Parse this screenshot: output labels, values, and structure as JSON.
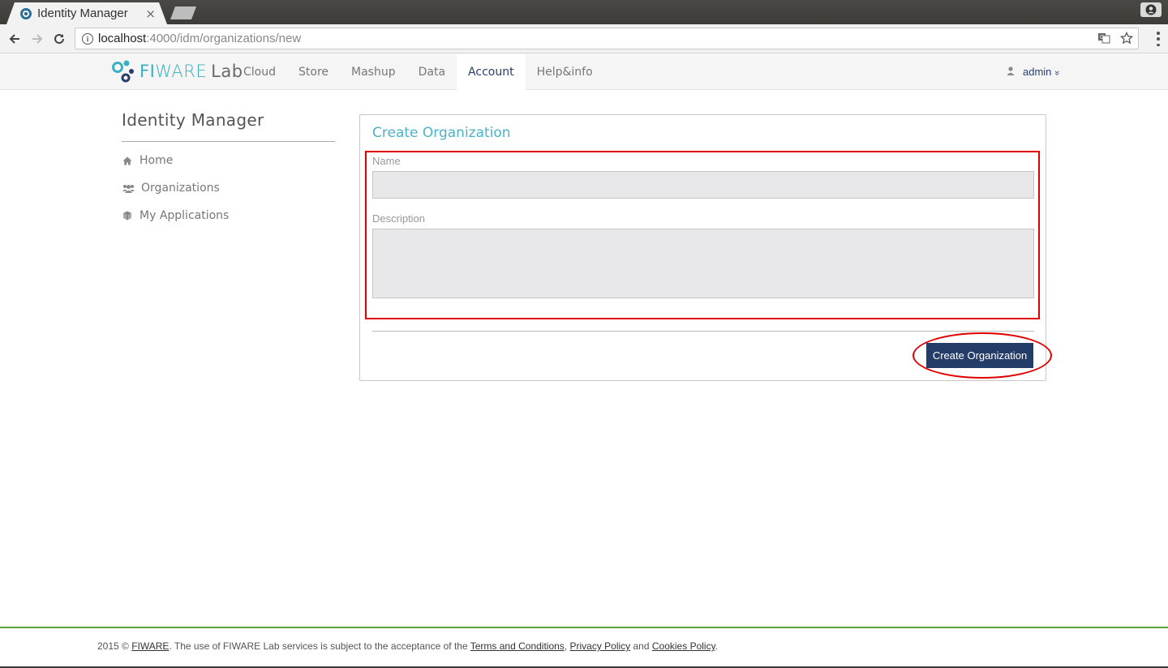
{
  "browser": {
    "tab_title": "Identity Manager",
    "tab_close": "×",
    "url_host": "localhost",
    "url_path": ":4000/idm/organizations/new"
  },
  "navbar": {
    "logo_fi": "FI",
    "logo_ware": "WARE",
    "logo_lab": "Lab",
    "items": [
      {
        "label": "Cloud",
        "active": false
      },
      {
        "label": "Store",
        "active": false
      },
      {
        "label": "Mashup",
        "active": false
      },
      {
        "label": "Data",
        "active": false
      },
      {
        "label": "Account",
        "active": true
      },
      {
        "label": "Help&info",
        "active": false
      }
    ],
    "user_label": "admin",
    "user_caret": "»"
  },
  "sidebar": {
    "title": "Identity Manager",
    "items": [
      {
        "label": "Home",
        "icon": "home-icon"
      },
      {
        "label": "Organizations",
        "icon": "users-icon"
      },
      {
        "label": "My Applications",
        "icon": "cube-icon"
      }
    ]
  },
  "form": {
    "title": "Create Organization",
    "name_label": "Name",
    "name_value": "",
    "description_label": "Description",
    "description_value": "",
    "submit_label": "Create Organization"
  },
  "footer": {
    "prefix": "2015 © ",
    "fiware_link": "FIWARE",
    "middle": ". The use of FIWARE Lab services is subject to the acceptance of the ",
    "terms_link": "Terms and Conditions",
    "sep1": ", ",
    "privacy_link": "Privacy Policy",
    "and": " and ",
    "cookies_link": "Cookies Policy",
    "suffix": "."
  },
  "colors": {
    "accent": "#4bb3c8",
    "primary_button": "#233c68",
    "annotation": "#e00000",
    "footer_line": "#5ea33f"
  }
}
